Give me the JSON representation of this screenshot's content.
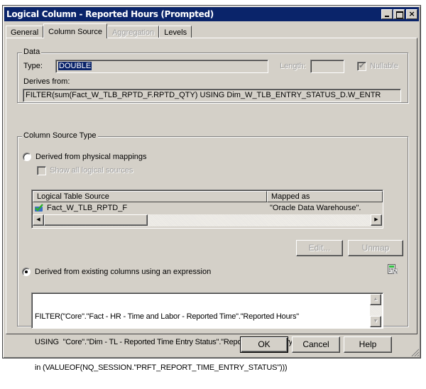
{
  "window": {
    "title": "Logical Column - Reported Hours (Prompted)",
    "controls": {
      "minimize": "minimize",
      "maximize": "maximize",
      "close": "×"
    }
  },
  "tabs": [
    {
      "label": "General",
      "state": "normal"
    },
    {
      "label": "Column Source",
      "state": "active"
    },
    {
      "label": "Aggregation",
      "state": "disabled"
    },
    {
      "label": "Levels",
      "state": "normal"
    }
  ],
  "data_group": {
    "title": "Data",
    "type_label": "Type:",
    "type_value": "DOUBLE",
    "length_label": "Length:",
    "length_value": "",
    "nullable_label": "Nullable",
    "nullable_checked": true,
    "derives_label": "Derives from:",
    "derives_value": "FILTER(sum(Fact_W_TLB_RPTD_F.RPTD_QTY) USING Dim_W_TLB_ENTRY_STATUS_D.W_ENTR"
  },
  "source_type_group": {
    "title": "Column Source Type",
    "physical_radio_label": "Derived from physical mappings",
    "physical_selected": false,
    "show_all_label": "Show all logical sources",
    "show_all_checked": false,
    "grid": {
      "columns": [
        "Logical Table Source",
        "Mapped as"
      ],
      "rows": [
        {
          "source": "Fact_W_TLB_RPTD_F",
          "mapped_as": "\"Oracle Data Warehouse\"."
        }
      ],
      "scroll_left": "◀",
      "scroll_right": "▶"
    },
    "edit_button": "Edit...",
    "unmap_button": "Unmap",
    "expression_radio_label": "Derived from existing columns using an expression",
    "expression_selected": true,
    "expression_lines": [
      "FILTER(\"Core\".\"Fact - HR - Time and Labor - Reported Time\".\"Reported Hours\"",
      "USING  \"Core\".\"Dim - TL - Reported Time Entry Status\".\"Reported Time Entry Status Code\"",
      "in (VALUEOF(NQ_SESSION.\"PRFT_REPORT_TIME_ENTRY_STATUS\")))"
    ],
    "scroll_up": "▲",
    "scroll_down": "▼"
  },
  "footer": {
    "ok": "OK",
    "cancel": "Cancel",
    "help": "Help"
  }
}
